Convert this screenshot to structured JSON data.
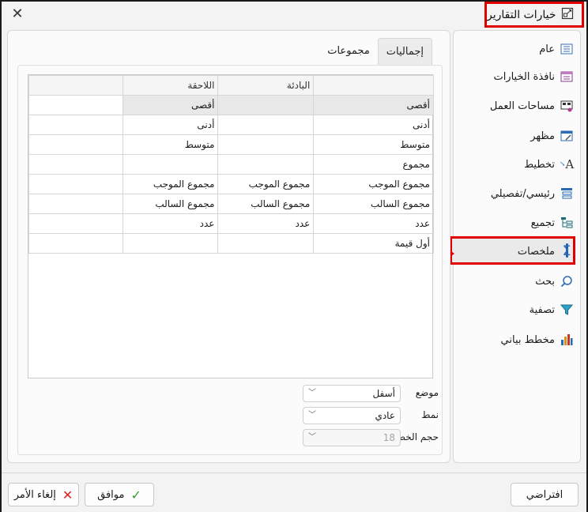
{
  "window": {
    "title": "خيارات التقارير"
  },
  "sidebar": {
    "items": [
      {
        "label": "عام",
        "icon": "general-list-icon"
      },
      {
        "label": "نافذة الخيارات",
        "icon": "options-window-icon"
      },
      {
        "label": "مساحات العمل",
        "icon": "workspaces-icon"
      },
      {
        "label": "مظهر",
        "icon": "appearance-icon"
      },
      {
        "label": "تخطيط",
        "icon": "layout-font-icon"
      },
      {
        "label": "رئيسي/تفصيلي",
        "icon": "master-detail-icon"
      },
      {
        "label": "تجميع",
        "icon": "grouping-icon"
      },
      {
        "label": "ملخصات",
        "icon": "sigma-icon",
        "selected": true
      },
      {
        "label": "بحث",
        "icon": "search-icon"
      },
      {
        "label": "تصفية",
        "icon": "filter-icon"
      },
      {
        "label": "مخطط بياني",
        "icon": "bar-chart-icon"
      }
    ]
  },
  "tabs": [
    {
      "label": "إجماليات",
      "active": true
    },
    {
      "label": "مجموعات",
      "active": false
    }
  ],
  "grid": {
    "headers": [
      "",
      "البادئة",
      "اللاحقة",
      ""
    ],
    "sub_headers": [
      "أقصى",
      "",
      "أقصى",
      ""
    ],
    "rows": [
      [
        "أدنى",
        "",
        "أدنى",
        ""
      ],
      [
        "متوسط",
        "",
        "متوسط",
        ""
      ],
      [
        "مجموع",
        "",
        "",
        ""
      ],
      [
        "مجموع الموجب",
        "مجموع الموجب",
        "مجموع الموجب",
        ""
      ],
      [
        "مجموع السالب",
        "مجموع السالب",
        "مجموع السالب",
        ""
      ],
      [
        "عدد",
        "عدد",
        "عدد",
        ""
      ],
      [
        "أول قيمة",
        "",
        "",
        ""
      ]
    ]
  },
  "fields": {
    "position": {
      "label": "موضع",
      "value": "أسفل"
    },
    "style": {
      "label": "نمط",
      "value": "عادي"
    },
    "font_size": {
      "label": "حجم الخط",
      "value": "18"
    }
  },
  "footer": {
    "default_label": "افتراضي",
    "ok_label": "موافق",
    "cancel_label": "إلغاء الأمر"
  },
  "colors": {
    "highlight": "#e00000",
    "accent": "#1d5fb8"
  }
}
